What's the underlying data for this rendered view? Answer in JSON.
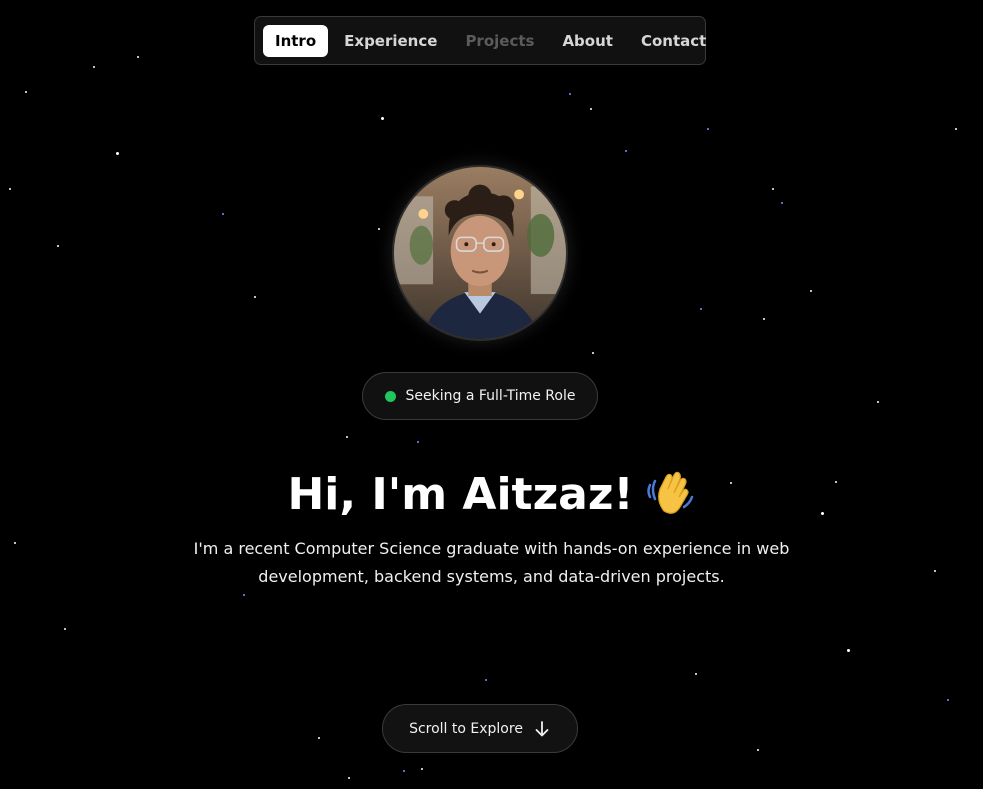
{
  "nav": {
    "items": [
      {
        "label": "Intro",
        "state": "active"
      },
      {
        "label": "Experience",
        "state": "normal"
      },
      {
        "label": "Projects",
        "state": "muted"
      },
      {
        "label": "About",
        "state": "normal"
      },
      {
        "label": "Contact",
        "state": "normal"
      }
    ]
  },
  "profile": {
    "avatar_icon": "profile-photo",
    "status": {
      "text": "Seeking a Full-Time Role",
      "color": "#22c55e"
    }
  },
  "hero": {
    "title": "Hi, I'm Aitzaz!",
    "title_icon": "waving-hand-icon",
    "description": "I'm a recent Computer Science graduate with hands-on experience in web development, backend systems, and data-driven projects."
  },
  "scroll": {
    "label": "Scroll to Explore",
    "icon": "arrow-down-icon"
  },
  "colors": {
    "background": "#000000",
    "accent_star": "#8a8cff",
    "status_dot": "#22c55e"
  }
}
